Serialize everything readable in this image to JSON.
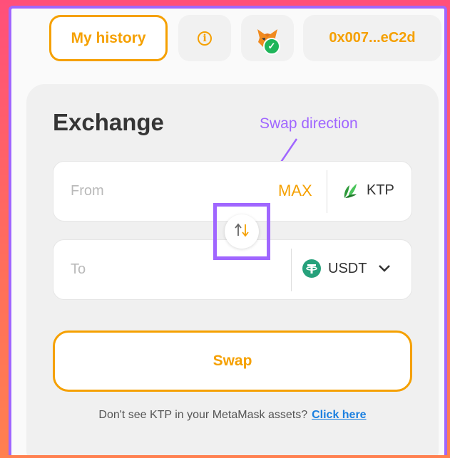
{
  "header": {
    "history_label": "My history",
    "info_icon": "info-icon",
    "wallet_icon": "metamask-fox-icon",
    "wallet_address": "0x007...eC2d"
  },
  "exchange": {
    "title": "Exchange",
    "annotation": "Swap direction",
    "from": {
      "placeholder": "From",
      "max_label": "MAX",
      "token": "KTP"
    },
    "to": {
      "placeholder": "To",
      "token": "USDT"
    },
    "swap_label": "Swap",
    "hint_text": "Don't see KTP in your MetaMask assets?",
    "hint_link": "Click here"
  },
  "colors": {
    "accent": "#f5a000",
    "annotation": "#a066ff",
    "link": "#1a7fe0",
    "connected": "#1fb55a"
  }
}
